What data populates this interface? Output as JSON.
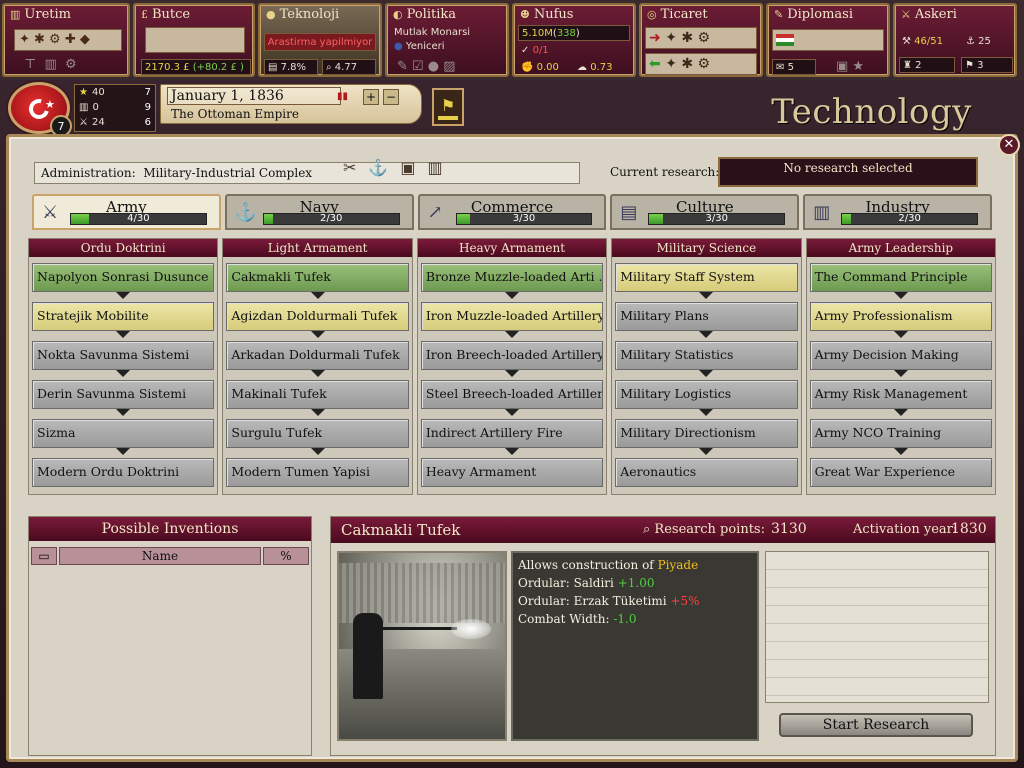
{
  "topbar": {
    "production": {
      "title": "Uretim",
      "icon": "factory-icon"
    },
    "budget": {
      "title": "Butce",
      "icon": "pound-icon",
      "value": "2170.3 £",
      "delta": "(+80.2 £ )"
    },
    "technology": {
      "title": "Teknoloji",
      "icon": "lightbulb-icon",
      "status": "Arastirma yapilmiyor",
      "literacy": "7.8%",
      "research": "4.77"
    },
    "politics": {
      "title": "Politika",
      "icon": "politics-icon",
      "government": "Mutlak Monarsi",
      "party": "Yeniceri"
    },
    "population": {
      "title": "Nufus",
      "icon": "people-icon",
      "total": "5.10M",
      "growth": "338",
      "ratio": "0/1",
      "militancy": "0.00",
      "consciousness": "0.73"
    },
    "trade": {
      "title": "Ticaret",
      "icon": "trade-icon"
    },
    "diplomacy": {
      "title": "Diplomasi",
      "icon": "diplomacy-icon",
      "count": "5"
    },
    "military": {
      "title": "Askeri",
      "icon": "military-icon",
      "forces": "46/51",
      "navy": "25",
      "mobilize": "2",
      "leaders": "3"
    }
  },
  "nation": {
    "rank": "7",
    "prestige": "40",
    "prestige_rank": "7",
    "industry": "0",
    "industry_rank": "9",
    "military": "24",
    "military_rank": "6",
    "date": "January 1, 1836",
    "name": "The Ottoman Empire"
  },
  "screen_title": "Technology",
  "administration": {
    "label": "Administration:",
    "value": "Military-Industrial Complex"
  },
  "current_research": {
    "label": "Current research:",
    "value": "No research selected"
  },
  "tabs": [
    {
      "name": "Army",
      "progress": "4/30",
      "fill": 0.133,
      "icon": "crossed-swords-icon",
      "active": true
    },
    {
      "name": "Navy",
      "progress": "2/30",
      "fill": 0.067,
      "icon": "anchor-icon",
      "active": false
    },
    {
      "name": "Commerce",
      "progress": "3/30",
      "fill": 0.1,
      "icon": "chart-icon",
      "active": false
    },
    {
      "name": "Culture",
      "progress": "3/30",
      "fill": 0.1,
      "icon": "book-icon",
      "active": false
    },
    {
      "name": "Industry",
      "progress": "2/30",
      "fill": 0.067,
      "icon": "factory-icon",
      "active": false
    }
  ],
  "columns": [
    {
      "name": "Ordu Doktrini",
      "techs": [
        {
          "name": "Napolyon Sonrasi Dusunce",
          "state": "done"
        },
        {
          "name": "Stratejik Mobilite",
          "state": "avail"
        },
        {
          "name": "Nokta Savunma Sistemi",
          "state": "locked"
        },
        {
          "name": "Derin Savunma Sistemi",
          "state": "locked"
        },
        {
          "name": "Sizma",
          "state": "locked"
        },
        {
          "name": "Modern Ordu Doktrini",
          "state": "locked"
        }
      ]
    },
    {
      "name": "Light Armament",
      "techs": [
        {
          "name": "Cakmakli Tufek",
          "state": "done"
        },
        {
          "name": "Agizdan Doldurmali Tufek",
          "state": "avail"
        },
        {
          "name": "Arkadan Doldurmali Tufek",
          "state": "locked"
        },
        {
          "name": "Makinali Tufek",
          "state": "locked"
        },
        {
          "name": "Surgulu Tufek",
          "state": "locked"
        },
        {
          "name": "Modern Tumen Yapisi",
          "state": "locked"
        }
      ]
    },
    {
      "name": "Heavy Armament",
      "techs": [
        {
          "name": "Bronze Muzzle-loaded Arti ...",
          "state": "done"
        },
        {
          "name": "Iron Muzzle-loaded Artillery",
          "state": "avail"
        },
        {
          "name": "Iron Breech-loaded Artillery",
          "state": "locked"
        },
        {
          "name": "Steel Breech-loaded Artillery",
          "state": "locked"
        },
        {
          "name": "Indirect Artillery Fire",
          "state": "locked"
        },
        {
          "name": "Heavy Armament",
          "state": "locked"
        }
      ]
    },
    {
      "name": "Military Science",
      "techs": [
        {
          "name": "Military Staff System",
          "state": "avail"
        },
        {
          "name": "Military Plans",
          "state": "locked"
        },
        {
          "name": "Military Statistics",
          "state": "locked"
        },
        {
          "name": "Military Logistics",
          "state": "locked"
        },
        {
          "name": "Military Directionism",
          "state": "locked"
        },
        {
          "name": "Aeronautics",
          "state": "locked"
        }
      ]
    },
    {
      "name": "Army Leadership",
      "techs": [
        {
          "name": "The Command Principle",
          "state": "done"
        },
        {
          "name": "Army Professionalism",
          "state": "avail"
        },
        {
          "name": "Army Decision Making",
          "state": "locked"
        },
        {
          "name": "Army Risk Management",
          "state": "locked"
        },
        {
          "name": "Army NCO Training",
          "state": "locked"
        },
        {
          "name": "Great War Experience",
          "state": "locked"
        }
      ]
    }
  ],
  "inventions": {
    "title": "Possible Inventions",
    "col_name": "Name",
    "col_pct": "%"
  },
  "detail": {
    "title": "Cakmakli Tufek",
    "rp_label": "Research points:",
    "rp_value": "3130",
    "ay_label": "Activation year:",
    "ay_value": "1830",
    "effects": [
      {
        "label": "Allows construction of ",
        "value": "Piyade",
        "color": "#f0c020"
      },
      {
        "label": "Ordular: Saldiri ",
        "value": "+1.00",
        "color": "#50d040"
      },
      {
        "label": "Ordular: Erzak Tüketimi ",
        "value": "+5%",
        "color": "#ff4040"
      },
      {
        "label": "Combat Width: ",
        "value": "-1.0",
        "color": "#50d040"
      }
    ],
    "start_button": "Start Research"
  }
}
